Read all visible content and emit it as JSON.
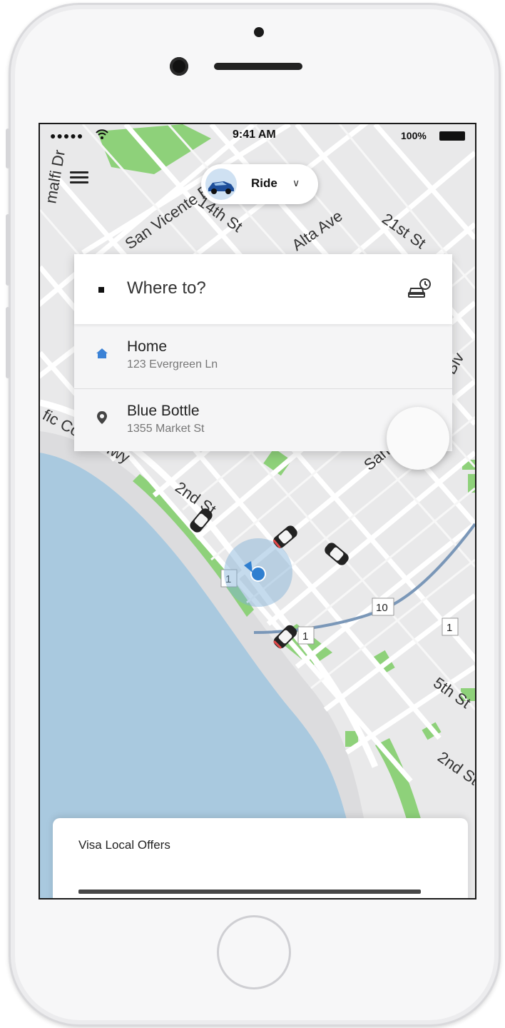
{
  "status_bar": {
    "signal": "●●●●●",
    "time": "9:41 AM",
    "battery": "100%"
  },
  "header": {
    "ride_label": "Ride",
    "ride_chevron": "∨"
  },
  "map": {
    "street_labels": [
      "San Vicente Blvd",
      "14th St",
      "Alta Ave",
      "21st St",
      "2nd St",
      "5th St",
      "2nd St",
      "malfi Dr",
      "fic Coast Hwy",
      "Blv",
      "San"
    ],
    "route_shields": [
      "1",
      "1",
      "10",
      "1"
    ]
  },
  "search": {
    "placeholder": "Where to?"
  },
  "saved_places": [
    {
      "title": "Home",
      "address": "123 Evergreen Ln",
      "icon": "home-icon"
    },
    {
      "title": "Blue Bottle",
      "address": "1355 Market St",
      "icon": "location-pin-icon"
    }
  ],
  "bottom_sheet": {
    "title": "Visa Local Offers"
  },
  "colors": {
    "map_bg": "#e9e9ea",
    "water": "#a9c9df",
    "park": "#8ed17a",
    "accent": "#3b82d6",
    "route": "#7a97b8"
  }
}
